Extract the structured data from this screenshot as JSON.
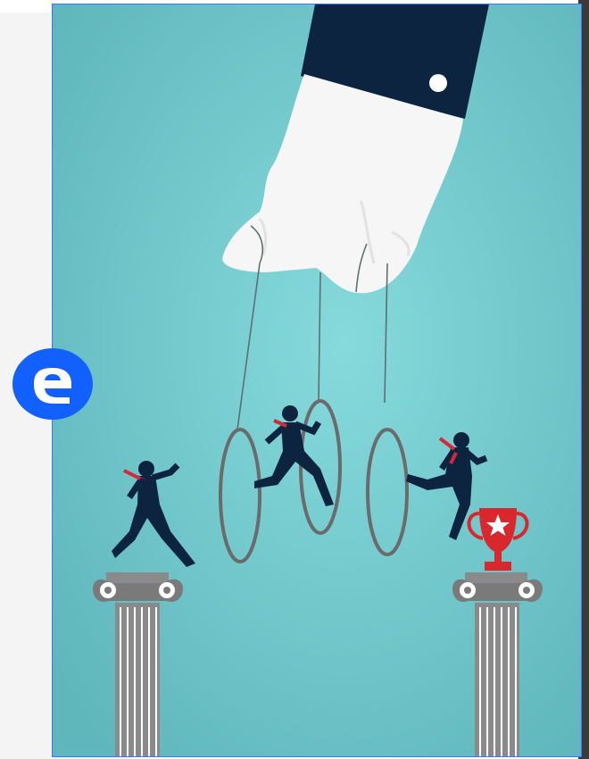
{
  "colors": {
    "background_teal": "#7fd3d6",
    "background_teal_dark": "#61b8bd",
    "suit": "#0c2440",
    "tie": "#d5283a",
    "hand": "#f6f6f6",
    "ring": "#6b6b6b",
    "trophy": "#d8282e",
    "column": "#888888",
    "badge_blue": "#1261ff",
    "frame_border": "#3b74ff"
  },
  "icons": {
    "badge": "letter-e-logo",
    "trophy": "star-trophy-icon"
  }
}
